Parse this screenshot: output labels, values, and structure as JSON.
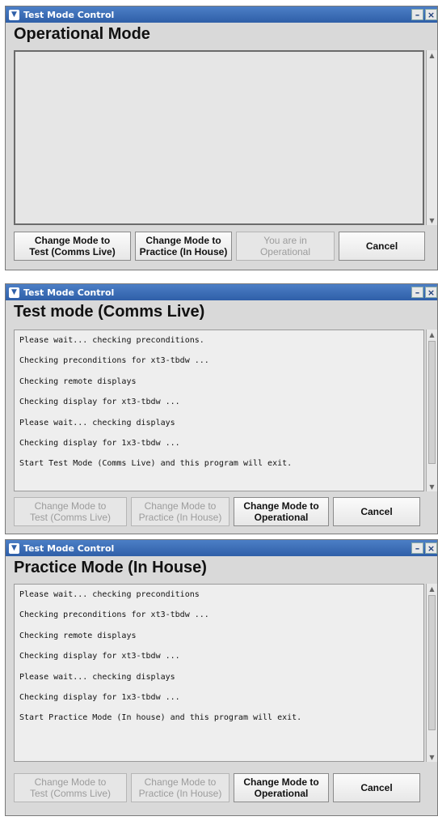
{
  "windows": [
    {
      "title": "Test Mode Control",
      "heading": "Operational Mode",
      "log_lines": [],
      "buttons": [
        {
          "label": "Change Mode to\nTest (Comms Live)",
          "enabled": true
        },
        {
          "label": "Change Mode to\nPractice (In House)",
          "enabled": true
        },
        {
          "label": "You are in\nOperational",
          "enabled": false
        },
        {
          "label": "Cancel",
          "enabled": true
        }
      ]
    },
    {
      "title": "Test Mode Control",
      "heading": "Test mode (Comms Live)",
      "log_lines": [
        "Please wait... checking preconditions.",
        "Checking preconditions for xt3-tbdw ...",
        "Checking remote displays",
        "Checking display for xt3-tbdw ...",
        "Please wait... checking displays",
        "Checking display for 1x3-tbdw ...",
        "Start Test Mode (Comms Live) and this program will exit."
      ],
      "buttons": [
        {
          "label": "Change Mode to\nTest (Comms Live)",
          "enabled": false
        },
        {
          "label": "Change Mode to\nPractice (In House)",
          "enabled": false
        },
        {
          "label": "Change Mode to\nOperational",
          "enabled": true
        },
        {
          "label": "Cancel",
          "enabled": true
        }
      ]
    },
    {
      "title": "Test Mode Control",
      "heading": "Practice Mode (In House)",
      "log_lines": [
        "Please wait... checking preconditions",
        "Checking preconditions for xt3-tbdw ...",
        "Checking remote displays",
        "Checking display for xt3-tbdw ...",
        "Please wait... checking displays",
        "Checking display for 1x3-tbdw ...",
        "Start Practice Mode (In house) and this program will exit."
      ],
      "buttons": [
        {
          "label": "Change Mode to\nTest (Comms Live)",
          "enabled": false
        },
        {
          "label": "Change Mode to\nPractice (In House)",
          "enabled": false
        },
        {
          "label": "Change Mode to\nOperational",
          "enabled": true
        },
        {
          "label": "Cancel",
          "enabled": true
        }
      ]
    }
  ],
  "titlebar_icons": {
    "menu": "chevron-down-icon",
    "minimize": "minimize-icon",
    "close": "close-icon"
  },
  "colors": {
    "titlebar": "#2f5fa8",
    "window_bg": "#d9d9d9",
    "disabled_text": "#9c9c9c"
  }
}
